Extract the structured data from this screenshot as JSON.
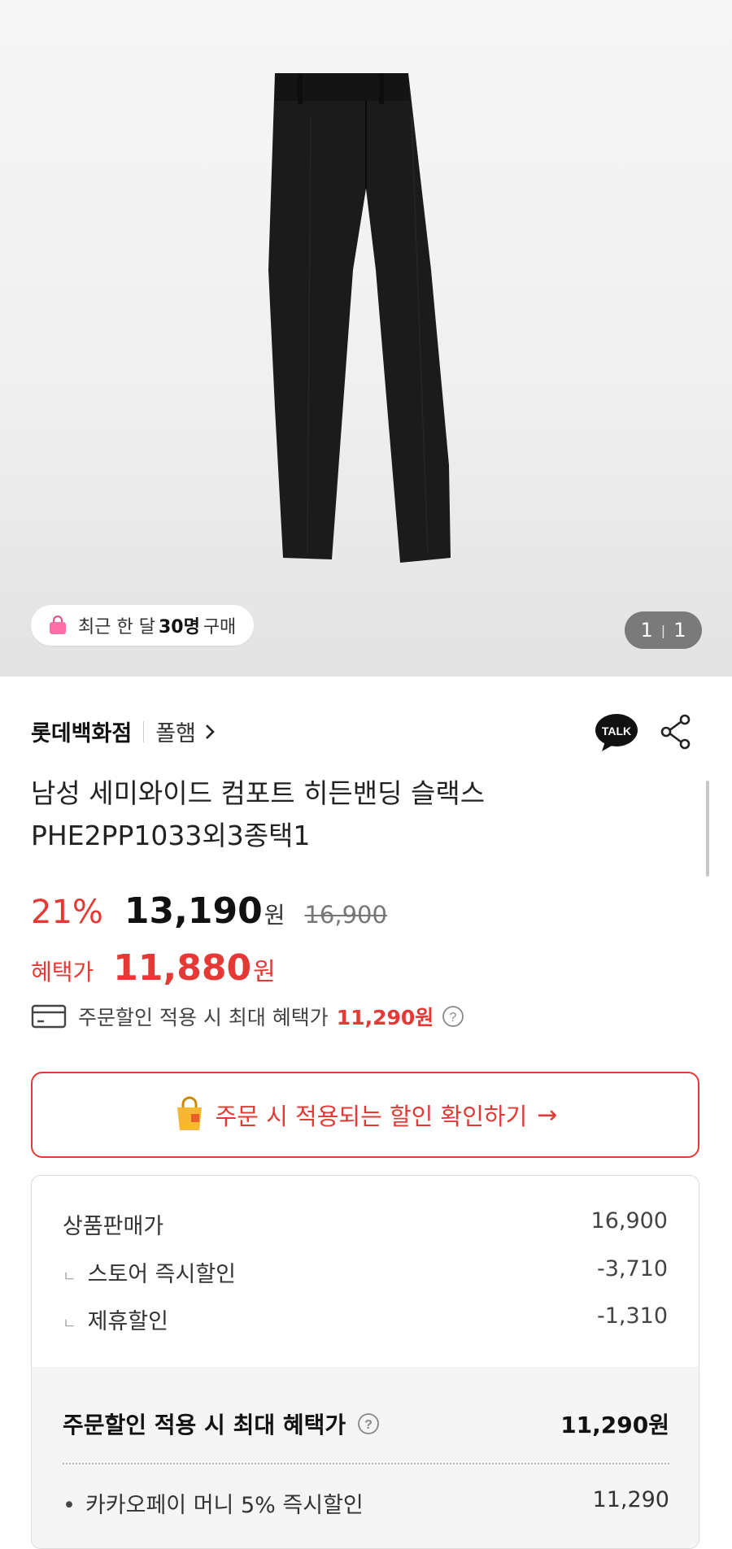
{
  "hero": {
    "recent_purchase": {
      "prefix": "최근 한 달",
      "count": "30명",
      "suffix": "구매"
    },
    "counter": {
      "current": "1",
      "total": "1"
    }
  },
  "store": {
    "name": "롯데백화점",
    "brand": "폴햄",
    "talk_label": "TALK"
  },
  "product": {
    "title_line1": "남성 세미와이드 컴포트 히든밴딩 슬랙스",
    "title_line2": "PHE2PP1033외3종택1"
  },
  "pricing": {
    "discount": "21%",
    "price": "13,190",
    "won": "원",
    "original": "16,900",
    "benefit_label": "혜택가",
    "benefit_price": "11,880",
    "max_text": "주문할인 적용 시 최대 혜택가",
    "max_price": "11,290원"
  },
  "discount_button": {
    "label": "주문 시 적용되는 할인 확인하기",
    "arrow": "→"
  },
  "breakdown": {
    "rows": [
      {
        "label": "상품판매가",
        "value": "16,900"
      },
      {
        "label": "스토어 즉시할인",
        "value": "-3,710"
      },
      {
        "label": "제휴할인",
        "value": "-1,310"
      }
    ],
    "total_label": "주문할인 적용 시 최대 혜택가",
    "total_value": "11,290원",
    "kakao_label": "카카오페이 머니 5% 즉시할인",
    "kakao_value": "11,290"
  },
  "colors": {
    "accent": "#e53935",
    "text": "#222222",
    "muted": "#777777"
  }
}
